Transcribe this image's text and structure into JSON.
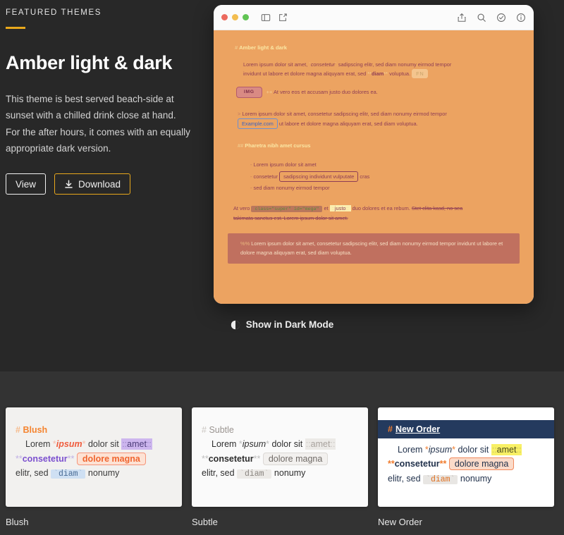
{
  "featured": {
    "eyebrow": "FEATURED THEMES",
    "title": "Amber light & dark",
    "description": "This theme is best served beach-side at sunset with a chilled drink close at hand. For the after hours, it comes with an equally appropriate dark version.",
    "view_label": "View",
    "download_label": "Download",
    "download_icon": "download-icon",
    "accent_color": "#e9a81c"
  },
  "preview": {
    "window_icons_left": [
      "sidebar-toggle-icon",
      "compose-icon"
    ],
    "window_icons_right": [
      "share-icon",
      "search-icon",
      "verified-icon",
      "info-icon"
    ],
    "traffic_lights": [
      "close-red",
      "minimize-yellow",
      "zoom-green"
    ],
    "background_color": "#eca361",
    "document": {
      "h1": {
        "hash": "#",
        "text": "Amber light & dark"
      },
      "p1": {
        "part1": "Lorem ipsum dolor sit amet, ",
        "code_tick_open": "`",
        "code": "consetetur",
        "code_tick_close": "`",
        "part2": " sadipscing elitr, sed diam nonumy eirmod tempor invidunt ut labore et dolore magna aliquyam erat, sed ",
        "bold_mark_open": "**",
        "bold": "diam",
        "bold_mark_close": "**",
        "part3": " voluptua.",
        "footnote_chip": "FN"
      },
      "img_line": {
        "chip": "IMG",
        "mark": "++",
        "text": "At vero eos et accusam justo duo dolores ea."
      },
      "quote": {
        "marker": ">",
        "part1": "Lorem ipsum dolor sit amet, consetetur sadipscing elitr, sed diam nonumy eirmod tempor ",
        "link": "Example.com",
        "part2": " ut labore et dolore magna aliquyam erat, sed diam voluptua."
      },
      "h2": {
        "hash": "##",
        "text": "Pharetra nibh amet cursus"
      },
      "list": [
        {
          "dash": "-",
          "text": "Lorem ipsum dolor sit amet"
        },
        {
          "dash": "-",
          "pre": "consetetur ",
          "tag": "sadipscing individunt vulputate",
          "post": " cras"
        },
        {
          "dash": "-",
          "text": "sed diam nonumy eirmod tempor"
        }
      ],
      "p2": {
        "part1": "At vero ",
        "code": "class=\"super\" id=\"mega\"",
        "part2": " et ",
        "highlight_open": "::",
        "highlight": "justo",
        "highlight_close": "::",
        "part3": " duo dolores et ea rebum. ",
        "strike": "Stet clita kasd, no sea takimata sanctus est. Lorem ipsum dolor sit amet."
      },
      "comment": {
        "marker": "%%",
        "text": "Lorem ipsum dolor sit amet, consetetur sadipscing elitr, sed diam nonumy eirmod tempor invidunt ut labore et dolore magna aliquyam erat, sed diam voluptua."
      }
    },
    "dark_mode_toggle": {
      "label": "Show in Dark Mode",
      "icon": "contrast-icon"
    }
  },
  "theme_cards": [
    {
      "name": "Blush",
      "label": "Blush",
      "heading_hash": "#",
      "heading": "Blush",
      "line1": {
        "pre": "Lorem ",
        "em_mark": "*",
        "em": "ipsum",
        "mid": " dolor sit ",
        "hl_mark": "::",
        "hl": "amet"
      },
      "line2": {
        "strong_mark": "**",
        "strong": "consetetur",
        "tag": "dolore magna"
      },
      "line3": {
        "pre": "elitr, sed ",
        "code_mark": "`",
        "code": "diam",
        "post": " nonumy"
      }
    },
    {
      "name": "Subtle",
      "label": "Subtle",
      "heading_hash": "#",
      "heading": "Subtle",
      "line1": {
        "pre": "Lorem ",
        "em_mark": "*",
        "em": "ipsum",
        "mid": " dolor sit ",
        "hl_mark": "::",
        "hl": "amet"
      },
      "line2": {
        "strong_mark": "**",
        "strong": "consetetur",
        "tag": "dolore magna"
      },
      "line3": {
        "pre": "elitr, sed ",
        "code_mark": "`",
        "code": "diam",
        "post": " nonumy"
      }
    },
    {
      "name": "New Order",
      "label": "New Order",
      "heading_hash": "#",
      "heading": "New Order",
      "line1": {
        "pre": "Lorem ",
        "em_mark": "*",
        "em": "ipsum",
        "mid": " dolor sit ",
        "hl_mark": "::",
        "hl": "amet"
      },
      "line2": {
        "strong_mark": "**",
        "strong": "consetetur",
        "tag": "dolore magna"
      },
      "line3": {
        "pre": "elitr, sed ",
        "code_mark": "`",
        "code": "diam",
        "post": " nonumy"
      }
    }
  ]
}
